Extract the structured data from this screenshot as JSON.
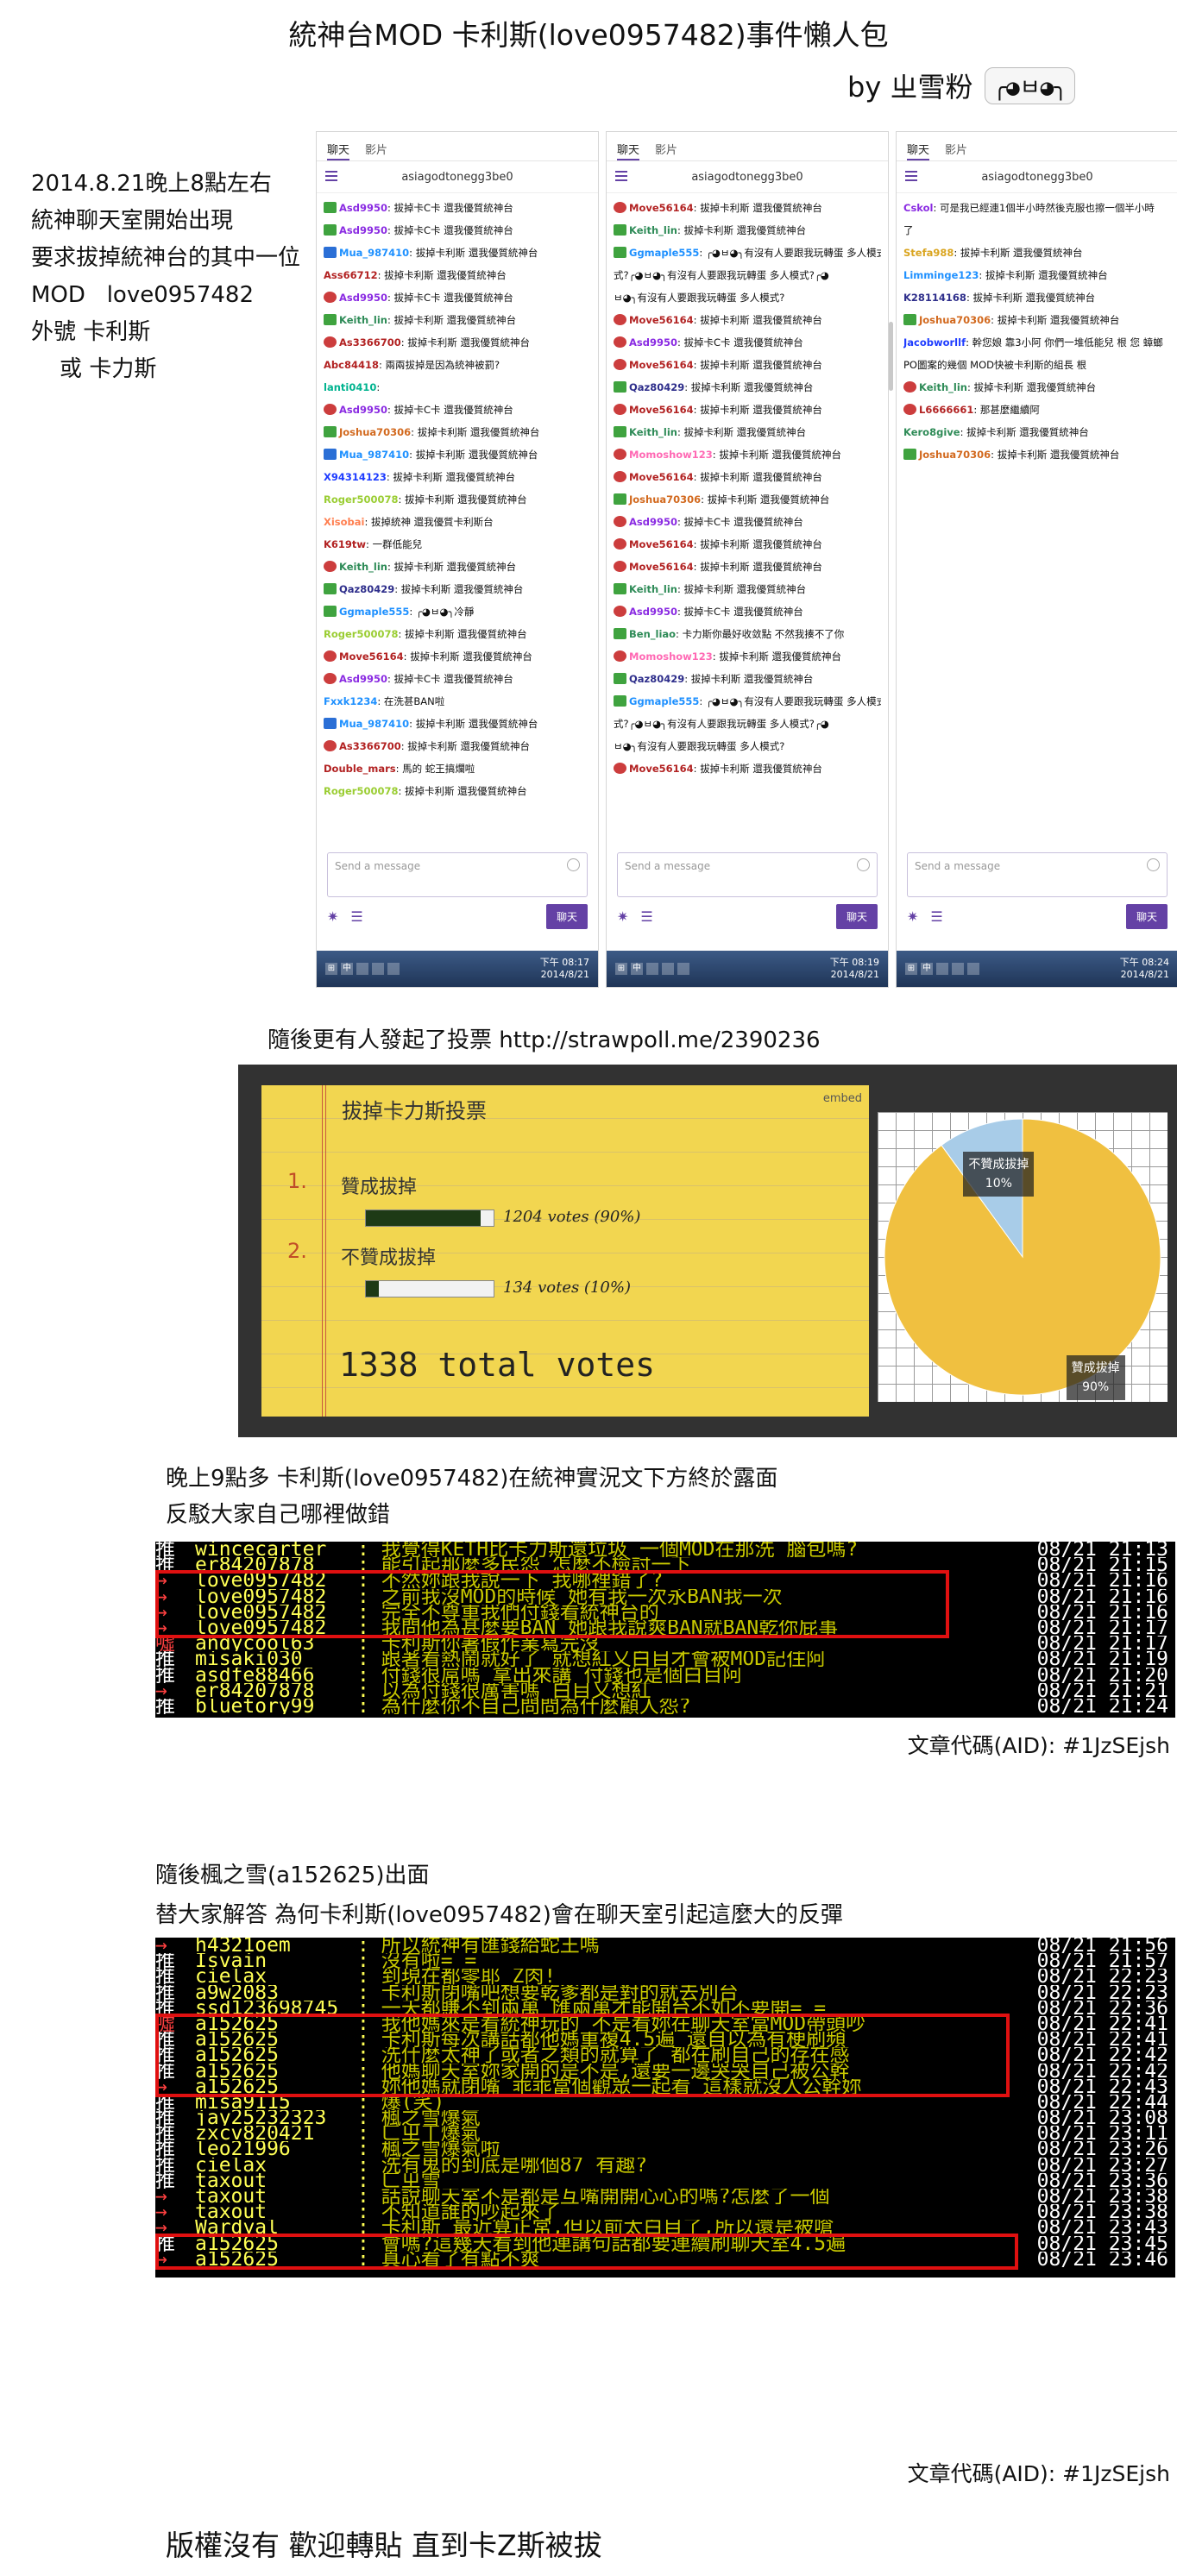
{
  "title": "統神台MOD 卡利斯(love0957482)事件懶人包",
  "byline": {
    "text": "by ㄓ雪粉",
    "kaomoji": "╭◕ㅂ◕╮"
  },
  "intro": [
    "2014.8.21晚上8點左右",
    "統神聊天室開始出現",
    "要求拔掉統神台的其中一位",
    "MOD   love0957482",
    "外號 卡利斯",
    "    或 卡力斯"
  ],
  "chat": {
    "tabs": [
      "聊天",
      "影片"
    ],
    "channel": "asiagodtonegg3be0",
    "input_placeholder": "Send a message",
    "send_label": "聊天",
    "panels": [
      {
        "clock": {
          "time": "下午 08:17",
          "date": "2014/8/21"
        },
        "messages": [
          {
            "b": "green",
            "user": "Asd9950",
            "color": "#8a2be2",
            "text": "拔掉卡C卡 還我優質統神台"
          },
          {
            "b": "green",
            "user": "Asd9950",
            "color": "#8a2be2",
            "text": "拔掉卡C卡 還我優質統神台"
          },
          {
            "b": "blue",
            "user": "Mua_987410",
            "color": "#1e90ff",
            "text": "拔掉卡利斯 還我優質統神台"
          },
          {
            "b": "",
            "user": "Ass66712",
            "color": "#b22222",
            "text": "拔掉卡利斯 還我優質統神台"
          },
          {
            "b": "red",
            "user": "Asd9950",
            "color": "#8a2be2",
            "text": "拔掉卡C卡 還我優質統神台"
          },
          {
            "b": "green",
            "user": "Keith_lin",
            "color": "#2e8b57",
            "text": "拔掉卡利斯 還我優質統神台"
          },
          {
            "b": "red",
            "user": "As3366700",
            "color": "#b22222",
            "text": "拔掉卡利斯 還我優質統神台"
          },
          {
            "b": "",
            "user": "Abc84418",
            "color": "#b22222",
            "text": "兩兩拔掉是因為統神被罰?"
          },
          {
            "b": "",
            "user": "lanti0410",
            "color": "#00b38f",
            "text": ""
          },
          {
            "b": "red",
            "user": "Asd9950",
            "color": "#8a2be2",
            "text": "拔掉卡C卡 還我優質統神台"
          },
          {
            "b": "green",
            "user": "Joshua70306",
            "color": "#d2691e",
            "text": "拔掉卡利斯 還我優質統神台"
          },
          {
            "b": "blue",
            "user": "Mua_987410",
            "color": "#1e90ff",
            "text": "拔掉卡利斯 還我優質統神台"
          },
          {
            "b": "",
            "user": "X94314123",
            "color": "#1e3cff",
            "text": "拔掉卡利斯 還我優質統神台"
          },
          {
            "b": "",
            "user": "Roger500078",
            "color": "#9acd32",
            "text": "拔掉卡利斯 還我優質統神台"
          },
          {
            "b": "",
            "user": "Xisobai",
            "color": "#ff7f50",
            "text": "拔掉統神 還我優質卡利斯台"
          },
          {
            "b": "",
            "user": "K619tw",
            "color": "#b22222",
            "text": "一群低能兒"
          },
          {
            "b": "red",
            "user": "Keith_lin",
            "color": "#2e8b57",
            "text": "拔掉卡利斯 還我優質統神台"
          },
          {
            "b": "green",
            "user": "Qaz80429",
            "color": "#2e2e8b",
            "text": "拔掉卡利斯 還我優質統神台"
          },
          {
            "b": "green",
            "user": "Ggmaple555",
            "color": "#1e90ff",
            "text": "╭◕ㅂ◕╮冷靜"
          },
          {
            "b": "",
            "user": "Roger500078",
            "color": "#9acd32",
            "text": "拔掉卡利斯 還我優質統神台"
          },
          {
            "b": "red",
            "user": "Move56164",
            "color": "#b22222",
            "text": "拔掉卡利斯 還我優質統神台"
          },
          {
            "b": "red",
            "user": "Asd9950",
            "color": "#8a2be2",
            "text": "拔掉卡C卡 還我優質統神台"
          },
          {
            "b": "",
            "user": "Fxxk1234",
            "color": "#1e90ff",
            "text": "在洗甚BAN啦"
          },
          {
            "b": "blue",
            "user": "Mua_987410",
            "color": "#1e90ff",
            "text": "拔掉卡利斯 還我優質統神台"
          },
          {
            "b": "red",
            "user": "As3366700",
            "color": "#b22222",
            "text": "拔掉卡利斯 還我優質統神台"
          },
          {
            "b": "",
            "user": "Double_mars",
            "color": "#b22222",
            "text": "馬的 蛇王搞爛啦"
          },
          {
            "b": "",
            "user": "Roger500078",
            "color": "#9acd32",
            "text": "拔掉卡利斯 還我優質統神台"
          }
        ]
      },
      {
        "clock": {
          "time": "下午 08:19",
          "date": "2014/8/21"
        },
        "messages": [
          {
            "b": "red",
            "user": "Move56164",
            "color": "#b22222",
            "text": "拔掉卡利斯 還我優質統神台"
          },
          {
            "b": "green",
            "user": "Keith_lin",
            "color": "#2e8b57",
            "text": "拔掉卡利斯 還我優質統神台"
          },
          {
            "b": "green",
            "user": "Ggmaple555",
            "color": "#1e90ff",
            "text": "╭◕ㅂ◕╮有沒有人要跟我玩轉蛋 多人模式"
          },
          {
            "b": "",
            "user": "",
            "color": "#333",
            "text": "式?╭◕ㅂ◕╮有沒有人要跟我玩轉蛋 多人模式?╭◕"
          },
          {
            "b": "",
            "user": "",
            "color": "#333",
            "text": "ㅂ◕╮有沒有人要跟我玩轉蛋 多人模式?"
          },
          {
            "b": "red",
            "user": "Move56164",
            "color": "#b22222",
            "text": "拔掉卡利斯 還我優質統神台"
          },
          {
            "b": "red",
            "user": "Asd9950",
            "color": "#8a2be2",
            "text": "拔掉卡C卡 還我優質統神台"
          },
          {
            "b": "red",
            "user": "Move56164",
            "color": "#b22222",
            "text": "拔掉卡利斯 還我優質統神台"
          },
          {
            "b": "green",
            "user": "Qaz80429",
            "color": "#2e2e8b",
            "text": "拔掉卡利斯 還我優質統神台"
          },
          {
            "b": "red",
            "user": "Move56164",
            "color": "#b22222",
            "text": "拔掉卡利斯 還我優質統神台"
          },
          {
            "b": "green",
            "user": "Keith_lin",
            "color": "#2e8b57",
            "text": "拔掉卡利斯 還我優質統神台"
          },
          {
            "b": "red",
            "user": "Momoshow123",
            "color": "#ff69b4",
            "text": "拔掉卡利斯 還我優質統神台"
          },
          {
            "b": "red",
            "user": "Move56164",
            "color": "#b22222",
            "text": "拔掉卡利斯 還我優質統神台"
          },
          {
            "b": "green",
            "user": "Joshua70306",
            "color": "#d2691e",
            "text": "拔掉卡利斯 還我優質統神台"
          },
          {
            "b": "red",
            "user": "Asd9950",
            "color": "#8a2be2",
            "text": "拔掉卡C卡 還我優質統神台"
          },
          {
            "b": "red",
            "user": "Move56164",
            "color": "#b22222",
            "text": "拔掉卡利斯 還我優質統神台"
          },
          {
            "b": "red",
            "user": "Move56164",
            "color": "#b22222",
            "text": "拔掉卡利斯 還我優質統神台"
          },
          {
            "b": "green",
            "user": "Keith_lin",
            "color": "#2e8b57",
            "text": "拔掉卡利斯 還我優質統神台"
          },
          {
            "b": "red",
            "user": "Asd9950",
            "color": "#8a2be2",
            "text": "拔掉卡C卡 還我優質統神台"
          },
          {
            "b": "green",
            "user": "Ben_liao",
            "color": "#2e8b57",
            "text": "卡力斯你最好收敛點 不然我揍不了你"
          },
          {
            "b": "red",
            "user": "Momoshow123",
            "color": "#ff69b4",
            "text": "拔掉卡利斯 還我優質統神台"
          },
          {
            "b": "green",
            "user": "Qaz80429",
            "color": "#2e2e8b",
            "text": "拔掉卡利斯 還我優質統神台"
          },
          {
            "b": "green",
            "user": "Ggmaple555",
            "color": "#1e90ff",
            "text": "╭◕ㅂ◕╮有沒有人要跟我玩轉蛋 多人模式"
          },
          {
            "b": "",
            "user": "",
            "color": "#333",
            "text": "式?╭◕ㅂ◕╮有沒有人要跟我玩轉蛋 多人模式?╭◕"
          },
          {
            "b": "",
            "user": "",
            "color": "#333",
            "text": "ㅂ◕╮有沒有人要跟我玩轉蛋 多人模式?"
          },
          {
            "b": "red",
            "user": "Move56164",
            "color": "#b22222",
            "text": "拔掉卡利斯 還我優質統神台"
          }
        ]
      },
      {
        "clock": {
          "time": "下午 08:24",
          "date": "2014/8/21"
        },
        "messages": [
          {
            "b": "",
            "user": "Cskol",
            "color": "#8a2be2",
            "text": "可是我已經連1個半小時然後克服也擦一個半小時"
          },
          {
            "b": "",
            "user": "",
            "color": "#333",
            "text": "了"
          },
          {
            "b": "",
            "user": "Stefa988",
            "color": "#daa520",
            "text": "拔掉卡利斯 還我優質統神台"
          },
          {
            "b": "",
            "user": "Limminge123",
            "color": "#1e90ff",
            "text": "拔掉卡利斯 還我優質統神台"
          },
          {
            "b": "",
            "user": "K28114168",
            "color": "#2e2e8b",
            "text": "拔掉卡利斯 還我優質統神台"
          },
          {
            "b": "green",
            "user": "Joshua70306",
            "color": "#d2691e",
            "text": "拔掉卡利斯 還我優質統神台"
          },
          {
            "b": "",
            "user": "Jacobworllf",
            "color": "#1e3cff",
            "text": "幹您娘 靠3小阿 你們一堆低能兒 根 您 蟑螂"
          },
          {
            "b": "",
            "user": "",
            "color": "#333",
            "text": "PO圖案的幾個 MOD快被卡利斯的組長 根"
          },
          {
            "b": "red",
            "user": "Keith_lin",
            "color": "#2e8b57",
            "text": "拔掉卡利斯 還我優質統神台"
          },
          {
            "b": "red",
            "user": "L6666661",
            "color": "#b22222",
            "text": "那甚麼繼續阿"
          },
          {
            "b": "",
            "user": "Kero8give",
            "color": "#2e8b57",
            "text": "拔掉卡利斯 還我優質統神台"
          },
          {
            "b": "green",
            "user": "Joshua70306",
            "color": "#d2691e",
            "text": "拔掉卡利斯 還我優質統神台"
          }
        ]
      }
    ]
  },
  "poll": {
    "caption": "隨後更有人發起了投票  http://strawpoll.me/2390236",
    "title": "拔掉卡力斯投票",
    "embed_label": "embed",
    "options": [
      {
        "num": "1.",
        "label": "贊成拔掉",
        "votes_text": "1204 votes (90%)",
        "fraction": 0.9
      },
      {
        "num": "2.",
        "label": "不贊成拔掉",
        "votes_text": "134 votes (10%)",
        "fraction": 0.1
      }
    ],
    "total": "1338 total votes"
  },
  "chart_data": {
    "type": "pie",
    "categories": [
      "贊成拔掉",
      "不贊成拔掉"
    ],
    "values": [
      90,
      10
    ],
    "labels": [
      "90%",
      "10%"
    ],
    "colors": [
      "#f0c040",
      "#a8cce8"
    ]
  },
  "section2": {
    "caption": [
      "晚上9點多 卡利斯(love0957482)在統神實況文下方終於露面",
      "反駁大家自己哪裡做錯"
    ],
    "aid": "文章代碼(AID): #1JzSEjsh",
    "lines": [
      {
        "tag": "推",
        "user": "wincecarter",
        "text": "我覺得KETH比卡力斯還垃圾 一個MOD在那洗 腦包嗎?",
        "time": "08/21 21:13"
      },
      {
        "tag": "推",
        "user": "er84207878",
        "text": "能引起那麼多民怨 怎麼不檢討一下",
        "time": "08/21 21:15"
      },
      {
        "tag": "→",
        "user": "love0957482",
        "text": "不然妳跟我說一下  我哪裡錯了?",
        "time": "08/21 21:16"
      },
      {
        "tag": "→",
        "user": "love0957482",
        "text": "之前我沒MOD的時候  她有我一次永BAN我一次",
        "time": "08/21 21:16"
      },
      {
        "tag": "→",
        "user": "love0957482",
        "text": "完全不尊重我們付錢看統神台的",
        "time": "08/21 21:16"
      },
      {
        "tag": "→",
        "user": "love0957482",
        "text": "我問他為甚麼要BAN  她跟我說爽BAN就BAN乾你屁事",
        "time": "08/21 21:17"
      },
      {
        "tag": "噓",
        "user": "andycool63",
        "text": "卡利斯你暑假作業寫完沒",
        "time": "08/21 21:17"
      },
      {
        "tag": "推",
        "user": "misaki030",
        "text": "跟著看熱鬧就好了  就想紅又白目才會被MOD記住阿",
        "time": "08/21 21:19"
      },
      {
        "tag": "推",
        "user": "asdfe88466",
        "text": "付錢很屌嗎  拿出來講  付錢也是個白目阿",
        "time": "08/21 21:20"
      },
      {
        "tag": "→",
        "user": "er84207878",
        "text": "以為付錢很厲害嗎  白目又想紅",
        "time": "08/21 21:21"
      },
      {
        "tag": "推",
        "user": "bluetory99",
        "text": "為什麼你不自己問問為什麼顧人怨?",
        "time": "08/21 21:24"
      }
    ]
  },
  "section3": {
    "caption": [
      "隨後楓之雪(a152625)出面",
      "替大家解答 為何卡利斯(love0957482)會在聊天室引起這麼大的反彈"
    ],
    "aid": "文章代碼(AID): #1JzSEjsh",
    "lines": [
      {
        "tag": "→",
        "user": "h4321oem",
        "text": "所以統神有匯錢給蛇王嗎",
        "time": "08/21 21:56"
      },
      {
        "tag": "推",
        "user": "Isvain",
        "text": "沒有啦=  =",
        "time": "08/21 21:57"
      },
      {
        "tag": "推",
        "user": "cielax",
        "text": "到現在都零耶  Z肉!",
        "time": "08/21 22:23"
      },
      {
        "tag": "推",
        "user": "a9w2083",
        "text": "卡利斯閉嘴吧想要乾爹都是對的就去別台",
        "time": "08/21 22:23"
      },
      {
        "tag": "推",
        "user": "ssd123698745",
        "text": "一天都賺不到兩萬  匯兩萬才能開台不如不要開=  =",
        "time": "08/21 22:36"
      },
      {
        "tag": "噓",
        "user": "a152625",
        "text": "我他媽來是看統神玩的  不是看妳在聊天室當MOD帶頭吵",
        "time": "08/21 22:41"
      },
      {
        "tag": "推",
        "user": "a152625",
        "text": "卡利斯每次講話都他媽重複4.5遍  還自以為有梗刷頻",
        "time": "08/21 22:41"
      },
      {
        "tag": "推",
        "user": "a152625",
        "text": "洗什麼太神了或者之類的就算了  都在刷自己的存在感",
        "time": "08/21 22:42"
      },
      {
        "tag": "推",
        "user": "a152625",
        "text": "他媽聊天室妳家開的是不是,還要一邊哭哭自己被公幹",
        "time": "08/21 22:42"
      },
      {
        "tag": "→",
        "user": "a152625",
        "text": "妳他媽就閉嘴  乖乖當個觀眾一起看  這樣就沒人公幹妳",
        "time": "08/21 22:43"
      },
      {
        "tag": "推",
        "user": "misa9115",
        "text": "爆(笑)",
        "time": "08/21 22:44"
      },
      {
        "tag": "推",
        "user": "jay25232323",
        "text": "楓之雪爆氣",
        "time": "08/21 23:08"
      },
      {
        "tag": "推",
        "user": "zxcv820421",
        "text": "ㄈㄓㄒ爆氣",
        "time": "08/21 23:11"
      },
      {
        "tag": "推",
        "user": "leo21996",
        "text": "楓之雪爆氣啦",
        "time": "08/21 23:26"
      },
      {
        "tag": "推",
        "user": "cielax",
        "text": "洗有鬼的到底是哪個87 有趣?",
        "time": "08/21 23:27"
      },
      {
        "tag": "推",
        "user": "taxout",
        "text": "ㄈㄓ雪",
        "time": "08/21 23:36"
      },
      {
        "tag": "→",
        "user": "taxout",
        "text": "話說聊天室不是都是互嘴開開心心的嗎?怎麼了一個",
        "time": "08/21 23:38"
      },
      {
        "tag": "→",
        "user": "taxout",
        "text": "不知道誰的吵起來了",
        "time": "08/21 23:38"
      },
      {
        "tag": "→",
        "user": "Wardyal",
        "text": "卡利斯  最近算正常,但以前太白目了,所以還是被嗆",
        "time": "08/21 23:43"
      },
      {
        "tag": "推",
        "user": "a152625",
        "text": "會嗎?這幾天看到他連講句話都要連續刷聊天室4.5遍",
        "time": "08/21 23:45"
      },
      {
        "tag": "→",
        "user": "a152625",
        "text": "真心看了有點不爽",
        "time": "08/21 23:46"
      }
    ]
  },
  "footer": "版權沒有 歡迎轉貼 直到卡Z斯被拔"
}
